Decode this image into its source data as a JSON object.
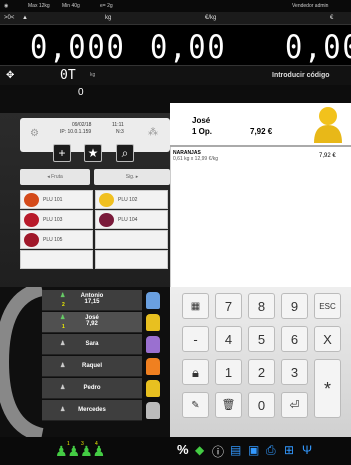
{
  "status": {
    "items": [
      "Max 12kg",
      "Min 40g",
      "e= 2g",
      "Vendedor admin"
    ]
  },
  "header": {
    "zero": ">0<",
    "units_kg": "kg",
    "units_eur_kg": "€/kg",
    "units_eur": "€"
  },
  "display": {
    "weight": "0,000",
    "price": "0,00",
    "total": "0,00"
  },
  "tare": {
    "label": "0T",
    "unit": "kg",
    "prompt": "Introducir código"
  },
  "counter": "0",
  "info": {
    "date": "09/02/18",
    "time": "11:11",
    "ip": "IP: 10.0.1.159",
    "n": "N:3"
  },
  "categories": {
    "first": "Fruta",
    "second": "Sig."
  },
  "products": [
    {
      "label": "PLU 101",
      "color": "#d44a1a"
    },
    {
      "label": "PLU 102",
      "color": "#f0c020"
    },
    {
      "label": "PLU 103",
      "color": "#b81a2a"
    },
    {
      "label": "PLU 104",
      "color": "#7a1a3a"
    },
    {
      "label": "PLU 105",
      "color": "#a0182a"
    }
  ],
  "customer": {
    "name": "José",
    "ops": "1 Op.",
    "total": "7,92 €"
  },
  "ticket": {
    "item": "NARANJAS",
    "detail": "0,61 kg x 12,99 €/kg",
    "amount": "7,92 €"
  },
  "sellers": [
    {
      "name": "Antonio",
      "amount": "17,15",
      "count": "2",
      "color": "#6aa0e0"
    },
    {
      "name": "José",
      "amount": "7,92",
      "count": "1",
      "color": "#e8c020"
    },
    {
      "name": "Sara",
      "amount": "",
      "count": "",
      "color": "#9a70d0"
    },
    {
      "name": "Raquel",
      "amount": "",
      "count": "",
      "color": "#f08020"
    },
    {
      "name": "Pedro",
      "amount": "",
      "count": "",
      "color": "#e8c020"
    },
    {
      "name": "Mercedes",
      "amount": "",
      "count": "",
      "color": "#bbbbbb"
    }
  ],
  "keypad": {
    "k7": "7",
    "k8": "8",
    "k9": "9",
    "esc": "ESC",
    "minus": "-",
    "k4": "4",
    "k5": "5",
    "k6": "6",
    "x": "X",
    "k1": "1",
    "k2": "2",
    "k3": "3",
    "star": "*",
    "k0": "0"
  },
  "footer": {
    "percent": "%",
    "badges": [
      "1",
      "3",
      "4"
    ]
  }
}
